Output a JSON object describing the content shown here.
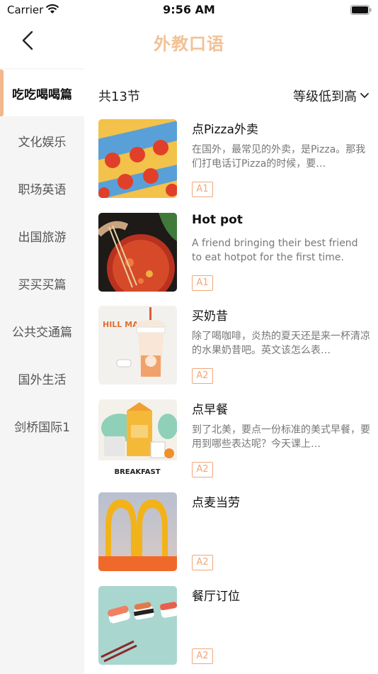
{
  "status": {
    "carrier": "Carrier",
    "time": "9:56 AM"
  },
  "nav": {
    "title": "外教口语",
    "title_color": "#f2c196"
  },
  "sidebar": {
    "items": [
      {
        "label": "吃吃喝喝篇"
      },
      {
        "label": "文化娱乐"
      },
      {
        "label": "职场英语"
      },
      {
        "label": "出国旅游"
      },
      {
        "label": "买买买篇"
      },
      {
        "label": "公共交通篇"
      },
      {
        "label": "国外生活"
      },
      {
        "label": "剑桥国际1"
      }
    ],
    "active": "吃吃喝喝篇"
  },
  "main": {
    "count": "共13节",
    "sort": "等级低到高",
    "lessons": [
      {
        "title": "点Pizza外卖",
        "desc": "在国外，最常见的外卖，是Pizza。那我们打电话订Pizza的时候，要…",
        "level": "A1",
        "thumb": "pizza-image"
      },
      {
        "title": "Hot pot",
        "desc": "A friend bringing their best friend to eat hotpot for the first time.",
        "level": "A1",
        "thumb": "hotpot-image"
      },
      {
        "title": "买奶昔",
        "desc": "除了喝咖啡，炎热的夏天还是来一杯清凉的水果奶昔吧。英文该怎么表…",
        "level": "A2",
        "thumb": "milkshake-image",
        "thumb_text": "HILL MAN"
      },
      {
        "title": "点早餐",
        "desc": "到了北美，要点一份标准的美式早餐，要用到哪些表达呢？今天课上…",
        "level": "A2",
        "thumb": "breakfast-image",
        "thumb_text": "BREAKFAST"
      },
      {
        "title": "点麦当劳",
        "desc": "",
        "level": "A2",
        "thumb": "mcdonalds-image"
      },
      {
        "title": "餐厅订位",
        "desc": "",
        "level": "A2",
        "thumb": "sushi-image"
      }
    ]
  },
  "colors": {
    "accent": "#f2b88b",
    "level_border": "#f0a77a",
    "sidebar_bg": "#f5f5f5"
  }
}
